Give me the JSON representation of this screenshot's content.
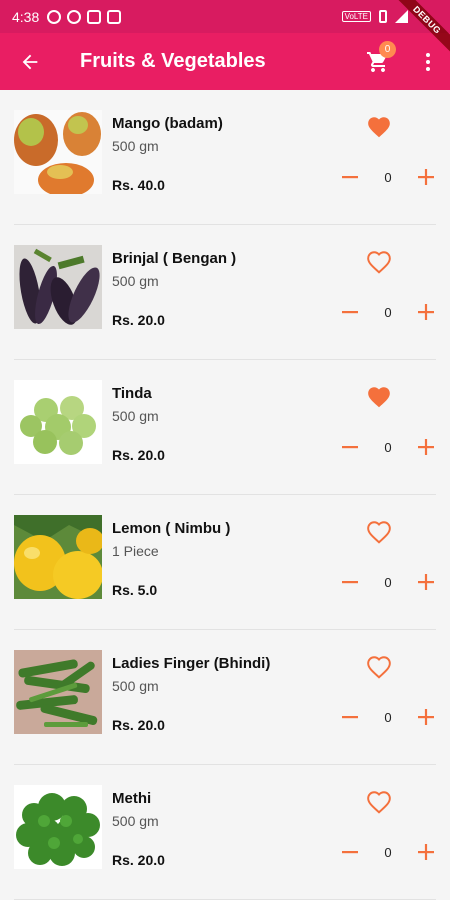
{
  "status_bar": {
    "time": "4:38",
    "network": "VoLTE"
  },
  "debug_label": "DEBUG",
  "app_bar": {
    "title": "Fruits & Vegetables",
    "cart_count": "0"
  },
  "colors": {
    "status": "#d81b60",
    "primary": "#e91e63",
    "accent": "#f4703c"
  },
  "products": [
    {
      "name": "Mango (badam)",
      "quantity": "500 gm",
      "price": "Rs. 40.0",
      "favorite": true,
      "count": "0",
      "image": "mango"
    },
    {
      "name": "Brinjal ( Bengan )",
      "quantity": "500 gm",
      "price": "Rs. 20.0",
      "favorite": false,
      "count": "0",
      "image": "brinjal"
    },
    {
      "name": "Tinda",
      "quantity": "500 gm",
      "price": "Rs. 20.0",
      "favorite": true,
      "count": "0",
      "image": "tinda"
    },
    {
      "name": "Lemon ( Nimbu )",
      "quantity": "1 Piece",
      "price": "Rs. 5.0",
      "favorite": false,
      "count": "0",
      "image": "lemon"
    },
    {
      "name": "Ladies Finger (Bhindi)",
      "quantity": "500 gm",
      "price": "Rs. 20.0",
      "favorite": false,
      "count": "0",
      "image": "okra"
    },
    {
      "name": "Methi",
      "quantity": "500 gm",
      "price": "Rs. 20.0",
      "favorite": false,
      "count": "0",
      "image": "methi"
    }
  ]
}
